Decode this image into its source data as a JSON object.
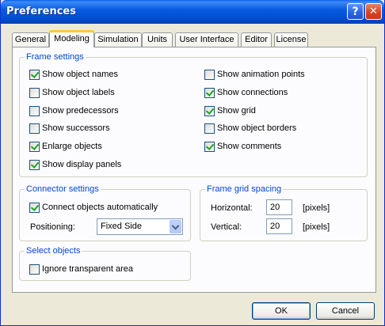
{
  "window": {
    "title": "Preferences"
  },
  "tabs": [
    {
      "label": "General"
    },
    {
      "label": "Modeling"
    },
    {
      "label": "Simulation"
    },
    {
      "label": "Units"
    },
    {
      "label": "User Interface"
    },
    {
      "label": "Editor"
    },
    {
      "label": "License"
    }
  ],
  "active_tab": "Modeling",
  "frame_settings": {
    "title": "Frame settings",
    "left": [
      {
        "label": "Show object names",
        "checked": true
      },
      {
        "label": "Show object labels",
        "checked": false
      },
      {
        "label": "Show predecessors",
        "checked": false
      },
      {
        "label": "Show successors",
        "checked": false
      },
      {
        "label": "Enlarge objects",
        "checked": true
      },
      {
        "label": "Show display panels",
        "checked": true
      }
    ],
    "right": [
      {
        "label": "Show animation points",
        "checked": false
      },
      {
        "label": "Show connections",
        "checked": true
      },
      {
        "label": "Show grid",
        "checked": true
      },
      {
        "label": "Show object borders",
        "checked": false
      },
      {
        "label": "Show comments",
        "checked": true
      }
    ]
  },
  "connector_settings": {
    "title": "Connector settings",
    "connect_auto": {
      "label": "Connect objects automatically",
      "checked": true
    },
    "positioning_label": "Positioning:",
    "positioning_value": "Fixed Side"
  },
  "frame_grid": {
    "title": "Frame grid spacing",
    "horizontal_label": "Horizontal:",
    "horizontal_value": "20",
    "vertical_label": "Vertical:",
    "vertical_value": "20",
    "unit": "[pixels]"
  },
  "select_objects": {
    "title": "Select objects",
    "ignore_transparent": {
      "label": "Ignore transparent area",
      "checked": false
    }
  },
  "buttons": {
    "ok": "OK",
    "cancel": "Cancel"
  }
}
